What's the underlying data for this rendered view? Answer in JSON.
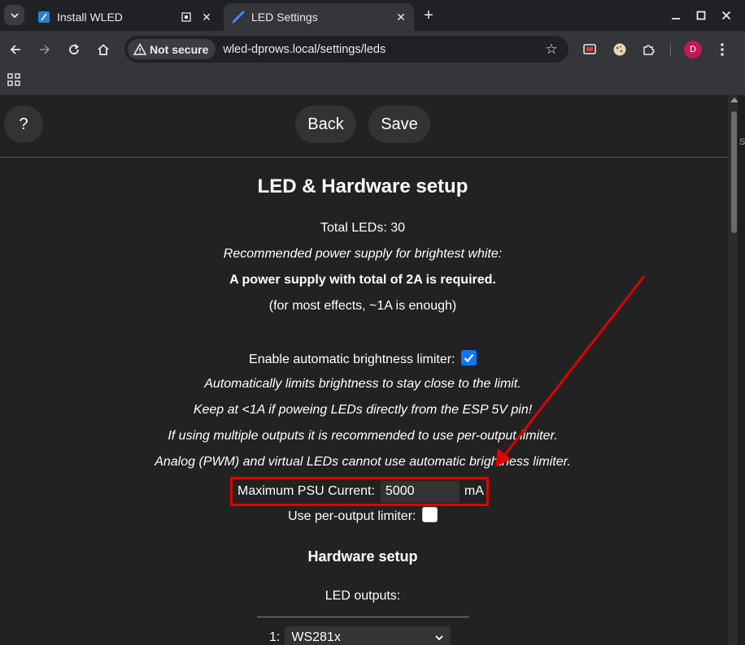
{
  "browser": {
    "tabs": [
      {
        "title": "Install WLED",
        "icon": "wled-favicon-icon"
      },
      {
        "title": "LED Settings",
        "icon": "wled-favicon-icon",
        "active": true
      }
    ],
    "security_label": "Not secure",
    "url": "wled-dprows.local/settings/leds",
    "profile_initial": "D"
  },
  "page": {
    "help_label": "?",
    "back_label": "Back",
    "save_label": "Save",
    "heading": "LED & Hardware setup",
    "total_leds": "Total LEDs: 30",
    "recommended": "Recommended power supply for brightest white:",
    "psu_required": "A power supply with total of 2A is required.",
    "most_effects": "(for most effects, ~1A is enough)",
    "abl_label": "Enable automatic brightness limiter:",
    "abl_enabled": true,
    "note1": "Automatically limits brightness to stay close to the limit.",
    "note2": "Keep at <1A if poweing LEDs directly from the ESP 5V pin!",
    "note3": "If using multiple outputs it is recommended to use per-output limiter.",
    "note4": "Analog (PWM) and virtual LEDs cannot use automatic brightness limiter.",
    "max_psu_label": "Maximum PSU Current:",
    "max_psu_value": "5000",
    "max_psu_unit": "mA",
    "per_output_label": "Use per-output limiter:",
    "per_output_enabled": false,
    "hardware_heading": "Hardware setup",
    "led_outputs_label": "LED outputs:",
    "output_index": "1:",
    "output_type": "WS281x"
  },
  "colors": {
    "highlight_box": "#e00000",
    "checkbox_accent": "#0b79ff"
  }
}
